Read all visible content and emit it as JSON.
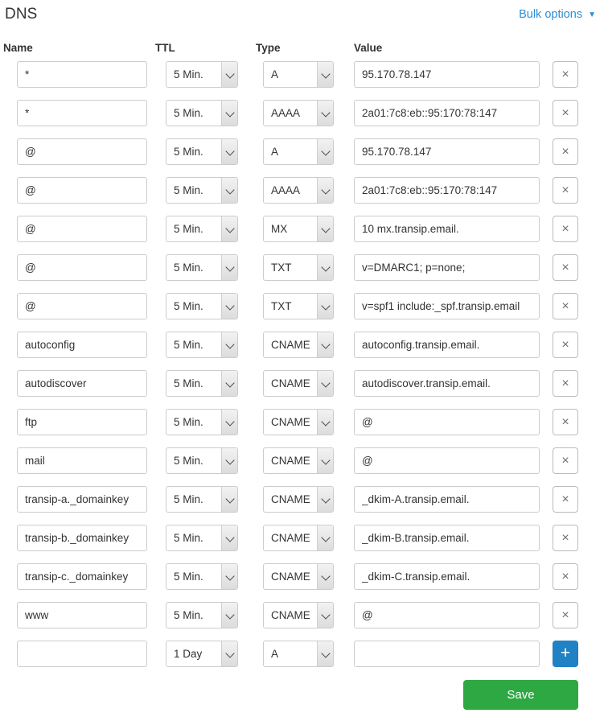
{
  "header": {
    "title": "DNS",
    "bulk_options_label": "Bulk options",
    "bulk_options_caret": "▼"
  },
  "columns": {
    "name": "Name",
    "ttl": "TTL",
    "type": "Type",
    "value": "Value"
  },
  "icons": {
    "delete": "×",
    "add": "+"
  },
  "colors": {
    "link": "#2b8fd4",
    "save_button": "#2ea843",
    "add_button": "#2081c4",
    "field_border": "#cccccc",
    "text": "#333333"
  },
  "new_row_placeholders": {
    "name": "",
    "value": ""
  },
  "records": [
    {
      "name": "*",
      "ttl": "5 Min.",
      "type": "A",
      "value": "95.170.78.147",
      "action": "delete"
    },
    {
      "name": "*",
      "ttl": "5 Min.",
      "type": "AAAA",
      "value": "2a01:7c8:eb::95:170:78:147",
      "action": "delete"
    },
    {
      "name": "@",
      "ttl": "5 Min.",
      "type": "A",
      "value": "95.170.78.147",
      "action": "delete"
    },
    {
      "name": "@",
      "ttl": "5 Min.",
      "type": "AAAA",
      "value": "2a01:7c8:eb::95:170:78:147",
      "action": "delete"
    },
    {
      "name": "@",
      "ttl": "5 Min.",
      "type": "MX",
      "value": "10 mx.transip.email.",
      "action": "delete"
    },
    {
      "name": "@",
      "ttl": "5 Min.",
      "type": "TXT",
      "value": "v=DMARC1; p=none;",
      "action": "delete"
    },
    {
      "name": "@",
      "ttl": "5 Min.",
      "type": "TXT",
      "value": "v=spf1 include:_spf.transip.email",
      "action": "delete"
    },
    {
      "name": "autoconfig",
      "ttl": "5 Min.",
      "type": "CNAME",
      "value": "autoconfig.transip.email.",
      "action": "delete"
    },
    {
      "name": "autodiscover",
      "ttl": "5 Min.",
      "type": "CNAME",
      "value": "autodiscover.transip.email.",
      "action": "delete"
    },
    {
      "name": "ftp",
      "ttl": "5 Min.",
      "type": "CNAME",
      "value": "@",
      "action": "delete"
    },
    {
      "name": "mail",
      "ttl": "5 Min.",
      "type": "CNAME",
      "value": "@",
      "action": "delete"
    },
    {
      "name": "transip-a._domainkey",
      "ttl": "5 Min.",
      "type": "CNAME",
      "value": "_dkim-A.transip.email.",
      "action": "delete"
    },
    {
      "name": "transip-b._domainkey",
      "ttl": "5 Min.",
      "type": "CNAME",
      "value": "_dkim-B.transip.email.",
      "action": "delete"
    },
    {
      "name": "transip-c._domainkey",
      "ttl": "5 Min.",
      "type": "CNAME",
      "value": "_dkim-C.transip.email.",
      "action": "delete"
    },
    {
      "name": "www",
      "ttl": "5 Min.",
      "type": "CNAME",
      "value": "@",
      "action": "delete"
    },
    {
      "name": "",
      "ttl": "1 Day",
      "type": "A",
      "value": "",
      "action": "add"
    }
  ],
  "footer": {
    "save_label": "Save"
  }
}
